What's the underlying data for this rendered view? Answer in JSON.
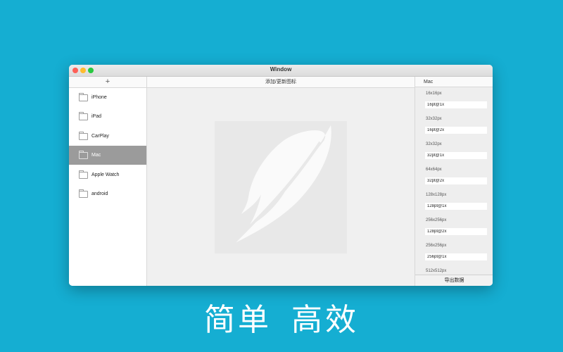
{
  "window": {
    "title": "Window"
  },
  "sidebar": {
    "add_label": "+",
    "items": [
      {
        "label": "iPhone",
        "selected": false
      },
      {
        "label": "iPad",
        "selected": false
      },
      {
        "label": "CarPlay",
        "selected": false
      },
      {
        "label": "Mac",
        "selected": true
      },
      {
        "label": "Apple Watch",
        "selected": false
      },
      {
        "label": "android",
        "selected": false
      }
    ]
  },
  "center": {
    "header_label": "添加/更新图标",
    "preview_icon": "feather-icon"
  },
  "right": {
    "header": "Mac",
    "sizes": [
      {
        "size": "16x16px",
        "value": "16pt@1x"
      },
      {
        "size": "32x32px",
        "value": "16pt@2x"
      },
      {
        "size": "32x32px",
        "value": "32pt@1x"
      },
      {
        "size": "64x64px",
        "value": "32pt@2x"
      },
      {
        "size": "128x128px",
        "value": "128pt@1x"
      },
      {
        "size": "256x256px",
        "value": "128pt@2x"
      },
      {
        "size": "256x256px",
        "value": "256pt@1x"
      },
      {
        "size": "512x512px",
        "value": ""
      }
    ],
    "export_label": "导出数据"
  },
  "slogan": "简单 高效",
  "colors": {
    "background": "#15aed2",
    "selected_row": "#9b9b9b"
  }
}
